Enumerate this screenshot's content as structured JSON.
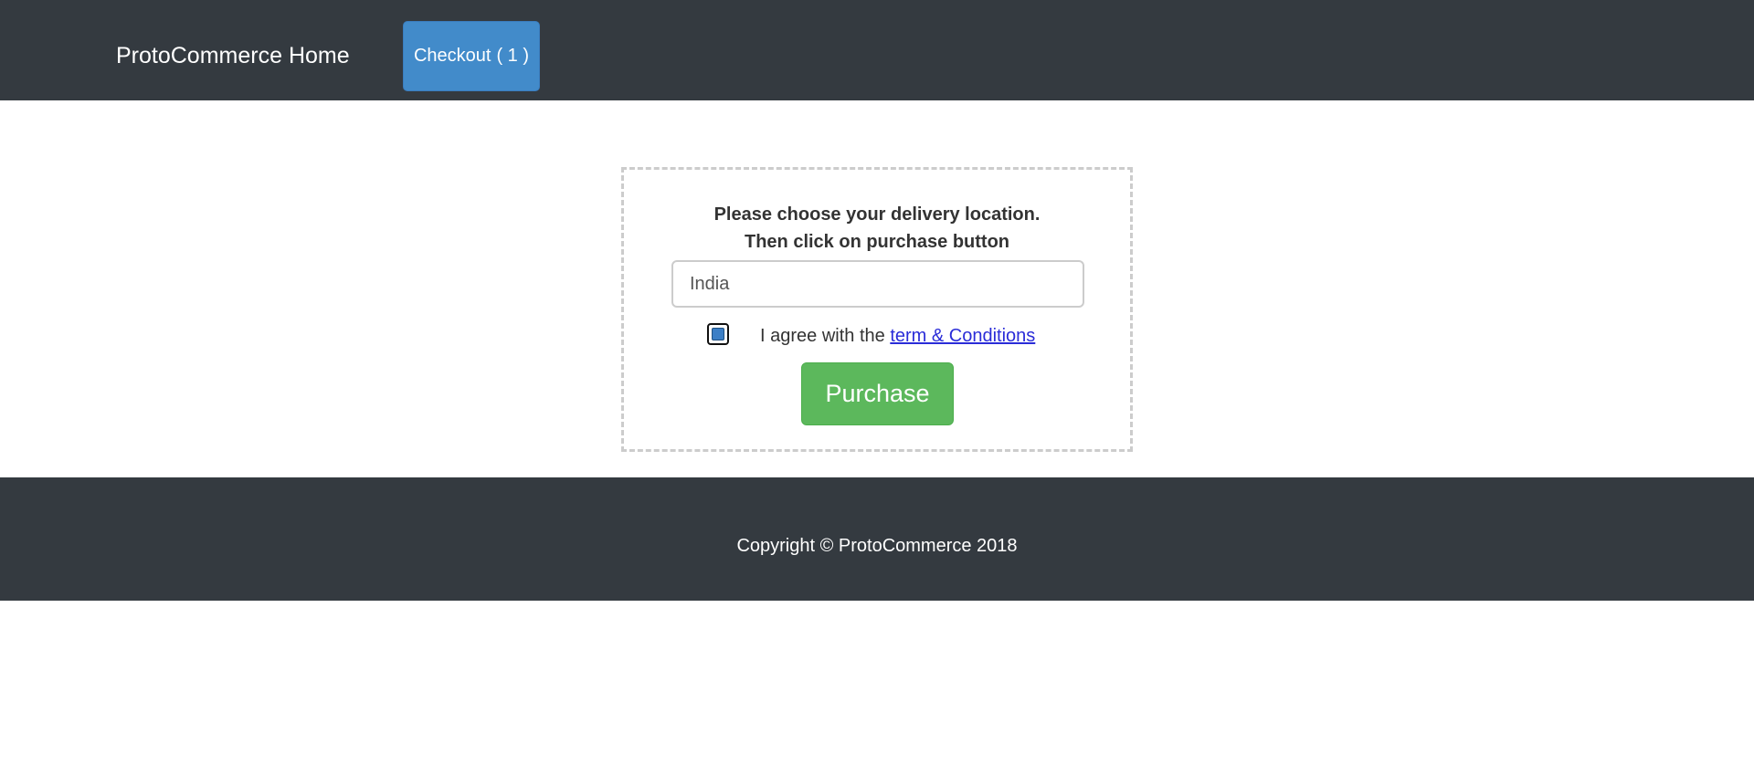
{
  "navbar": {
    "brand": "ProtoCommerce Home",
    "checkout_label": "Checkout",
    "checkout_count": "( 1 )"
  },
  "checkout": {
    "instruction_line1": "Please choose your delivery location.",
    "instruction_line2": "Then click on purchase button",
    "country_value": "India",
    "agree_text": "I agree with the ",
    "terms_link": "term & Conditions",
    "agree_checked": true,
    "purchase_label": "Purchase"
  },
  "footer": {
    "copyright": "Copyright © ProtoCommerce 2018"
  },
  "colors": {
    "navbar_bg": "#343a40",
    "checkout_button": "#428bca",
    "purchase_button": "#5cb85c",
    "link": "#2a2cd8"
  }
}
